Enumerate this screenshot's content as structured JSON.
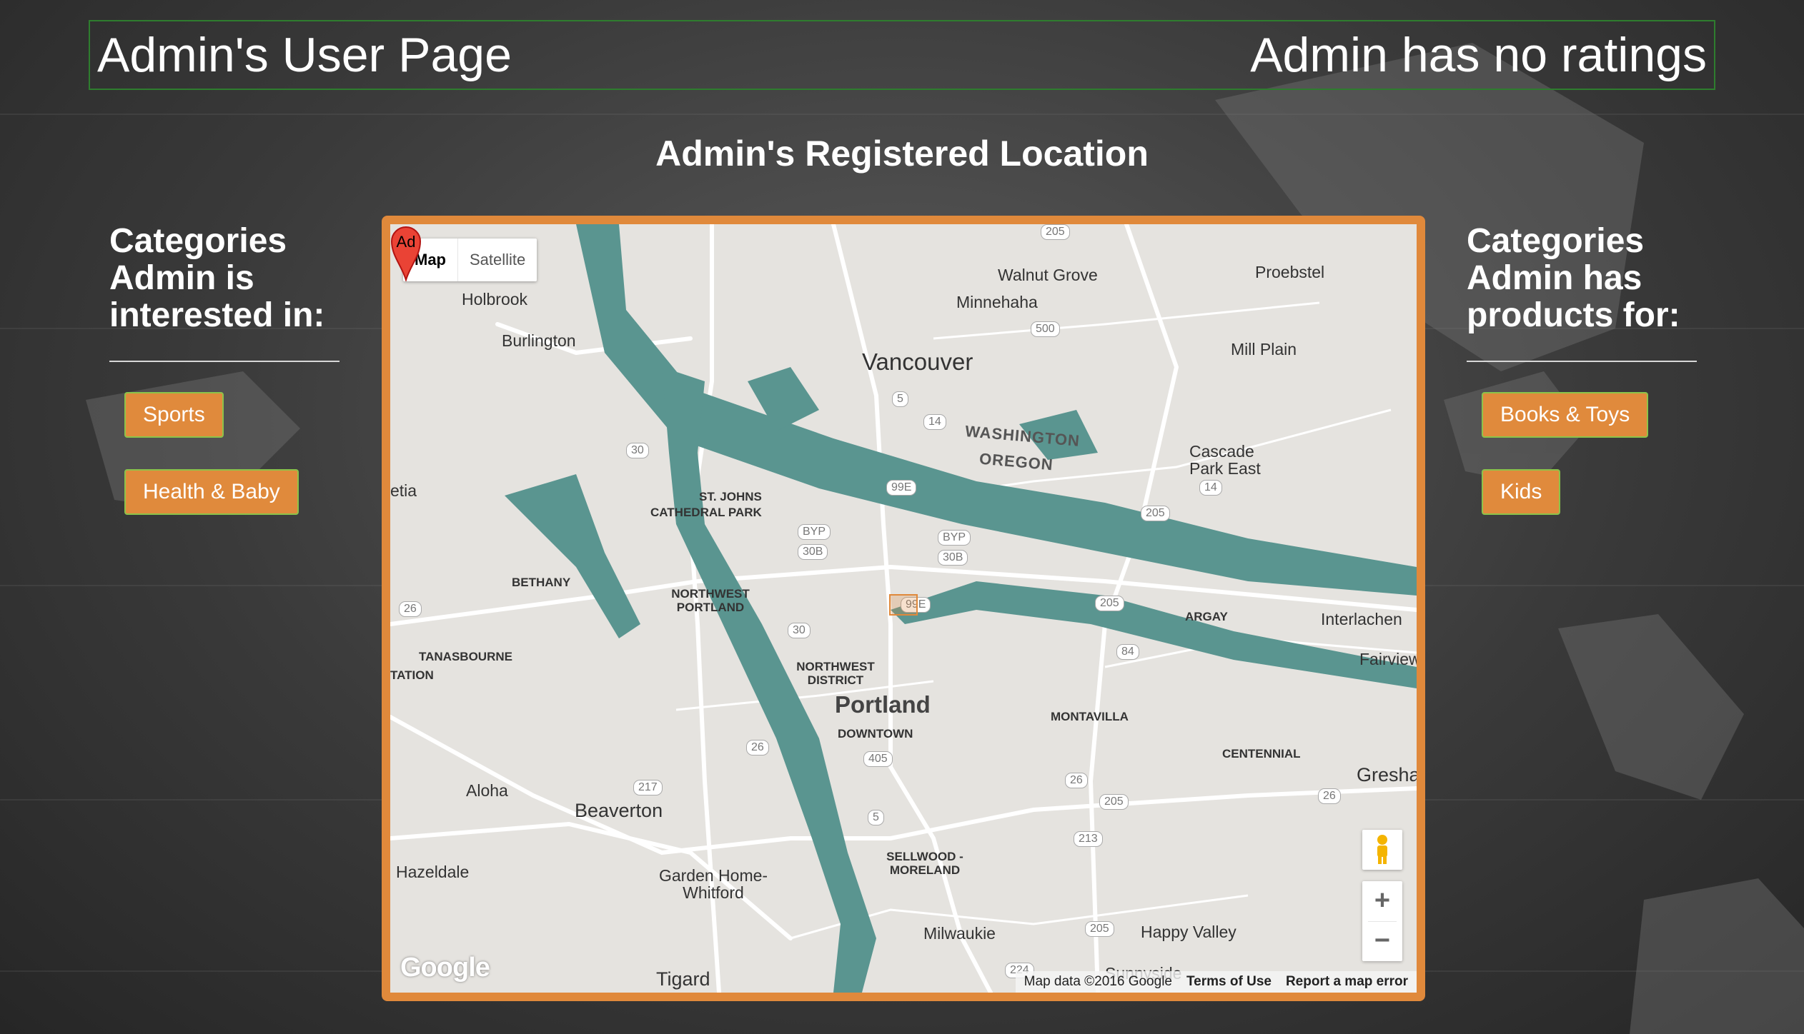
{
  "header": {
    "title": "Admin's User Page",
    "ratings": "Admin has no ratings"
  },
  "location": {
    "title": "Admin's Registered Location"
  },
  "interests": {
    "heading": "Categories Admin is interested in:",
    "items": [
      "Sports",
      "Health & Baby"
    ]
  },
  "products": {
    "heading": "Categories Admin has products for:",
    "items": [
      "Books & Toys",
      "Kids"
    ]
  },
  "map": {
    "types": [
      "Map",
      "Satellite"
    ],
    "selected_type": "Map",
    "marker_label": "Ad",
    "logo": "Google",
    "attribution": [
      "Map data ©2016 Google",
      "Terms of Use",
      "Report a map error"
    ],
    "zoom_in": "+",
    "zoom_out": "−",
    "places": {
      "holbrook": "Holbrook",
      "burlington": "Burlington",
      "walnut_grove": "Walnut Grove",
      "minnehaha": "Minnehaha",
      "proebstel": "Proebstel",
      "vancouver": "Vancouver",
      "mill_plain": "Mill Plain",
      "washington": "WASHINGTON",
      "oregon": "OREGON",
      "cascade_park_east": "Cascade Park East",
      "st_johns": "ST. JOHNS",
      "cathedral_park": "CATHEDRAL PARK",
      "bethany": "BETHANY",
      "northwest_portland": "NORTHWEST PORTLAND",
      "argay": "ARGAY",
      "interlachen": "Interlachen",
      "fairview": "Fairview",
      "tanasbourne": "TANASBOURNE",
      "tation": "TATION",
      "northwest_district": "NORTHWEST DISTRICT",
      "portland": "Portland",
      "downtown": "DOWNTOWN",
      "montavilla": "MONTAVILLA",
      "centennial": "CENTENNIAL",
      "gresham": "Gresha",
      "aloha": "Aloha",
      "beaverton": "Beaverton",
      "hazeldale": "Hazeldale",
      "garden_home": "Garden Home-Whitford",
      "sellwood": "SELLWOOD - MORELAND",
      "milwaukie": "Milwaukie",
      "happy_valley": "Happy Valley",
      "sunnyside": "Sunnyside",
      "tigard": "Tigard",
      "etia": "etia"
    },
    "shields": {
      "s205_top": "205",
      "s500": "500",
      "s5_top": "5",
      "s14_a": "14",
      "s30_a": "30",
      "s99e_a": "99E",
      "s14_b": "14",
      "s205_mid": "205",
      "s30b_a": "30B",
      "s30b_b": "30B",
      "s99e_b": "99E",
      "s26_w": "26",
      "s30_b": "30",
      "s205_c": "205",
      "s84": "84",
      "s26_a": "26",
      "s405": "405",
      "s217": "217",
      "s26_b": "26",
      "s205_d": "205",
      "s26_c": "26",
      "s5_b": "5",
      "s213": "213",
      "s205_e": "205",
      "s224": "224",
      "byp_a": "BYP",
      "byp_b": "BYP"
    }
  }
}
